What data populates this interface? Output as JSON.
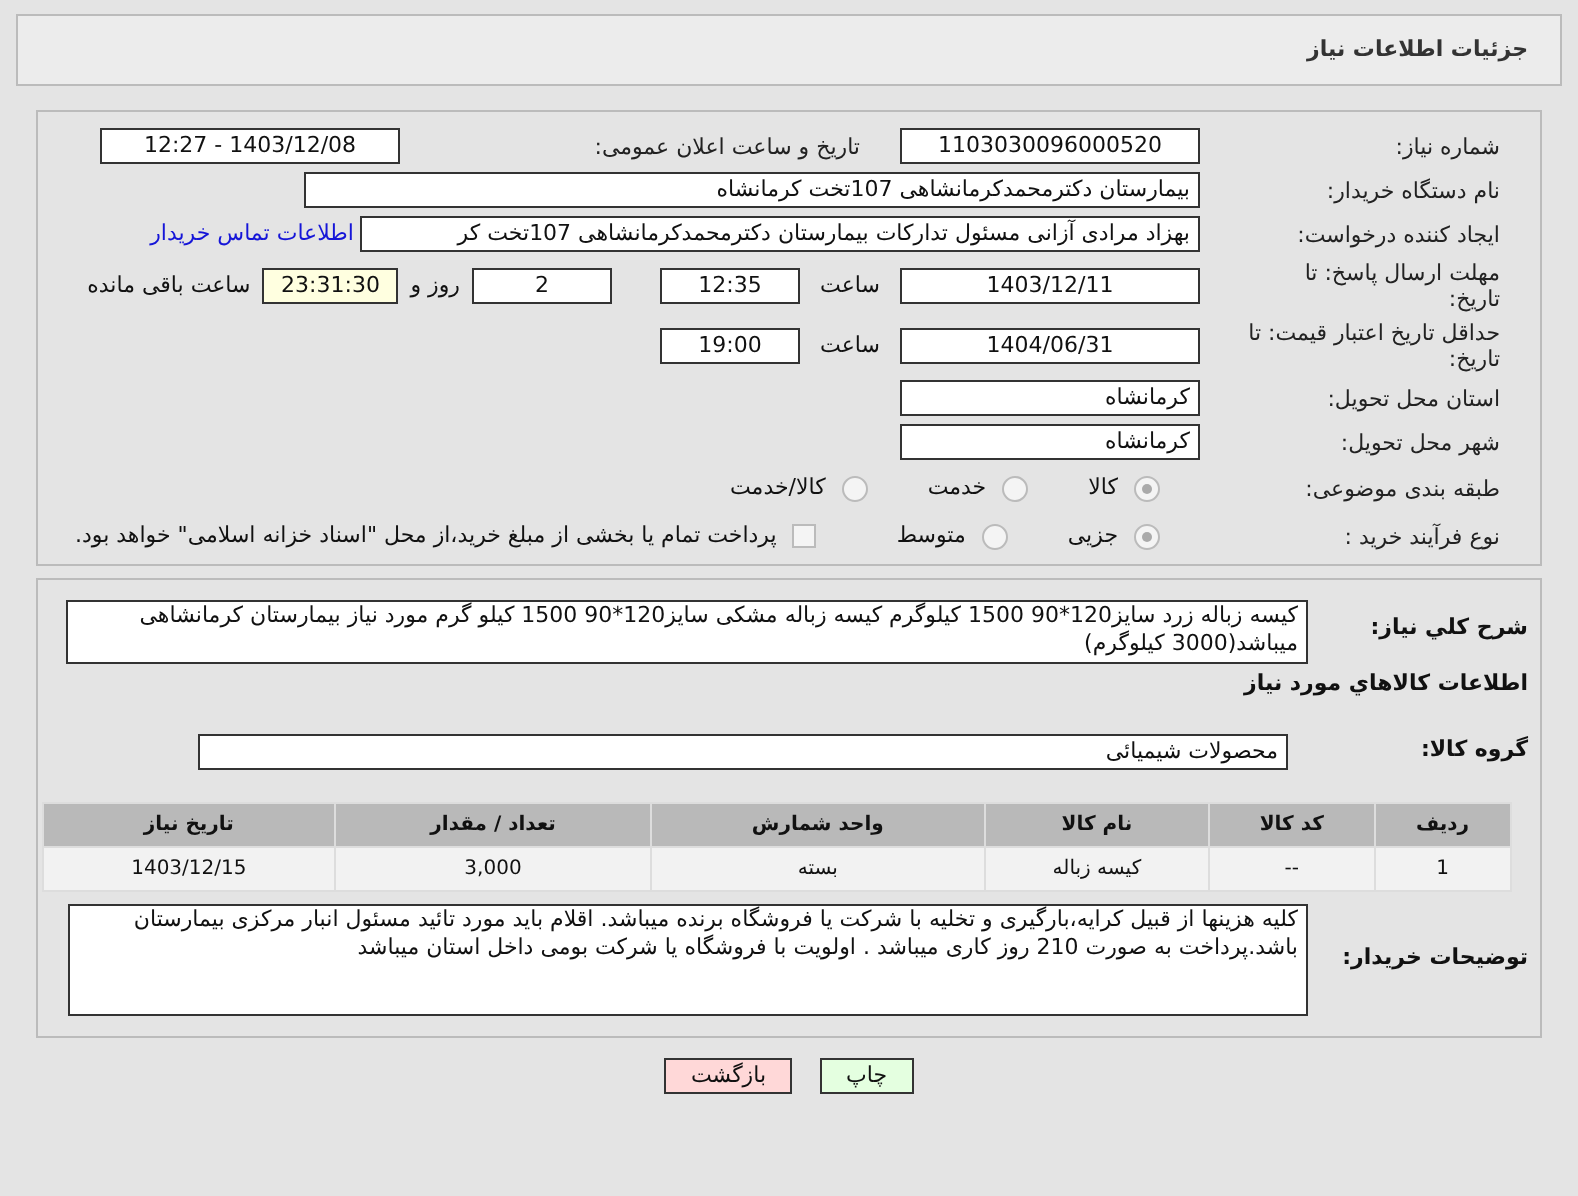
{
  "header": {
    "title": "جزئیات اطلاعات نیاز"
  },
  "need_number": {
    "label": "شماره نیاز:",
    "value": "1103030096000520"
  },
  "announce": {
    "label": "تاریخ و ساعت اعلان عمومی:",
    "value": "1403/12/08 - 12:27"
  },
  "buyer_org": {
    "label": "نام دستگاه خریدار:",
    "value": "بیمارستان دکترمحمدکرمانشاهی 107تخت کرمانشاه"
  },
  "requester": {
    "label": "ایجاد کننده درخواست:",
    "value": "بهزاد مرادی آزانی مسئول تدارکات بیمارستان دکترمحمدکرمانشاهی 107تخت کر",
    "link": "اطلاعات تماس خریدار"
  },
  "deadline": {
    "label": "مهلت ارسال پاسخ: تا\nتاریخ:",
    "date": "1403/12/11",
    "time_label": "ساعت",
    "time": "12:35",
    "days": "2",
    "days_label": "روز و",
    "remaining": "23:31:30",
    "remaining_label": "ساعت باقی مانده"
  },
  "validity": {
    "label": "حداقل تاریخ اعتبار قیمت: تا\nتاریخ:",
    "date": "1404/06/31",
    "time_label": "ساعت",
    "time": "19:00"
  },
  "province": {
    "label": "استان محل تحویل:",
    "value": "کرمانشاه"
  },
  "city": {
    "label": "شهر محل تحویل:",
    "value": "کرمانشاه"
  },
  "category": {
    "label": "طبقه بندی موضوعی:",
    "options": [
      {
        "label": "کالا",
        "selected": true
      },
      {
        "label": "خدمت",
        "selected": false
      },
      {
        "label": "کالا/خدمت",
        "selected": false
      }
    ]
  },
  "process": {
    "label": "نوع فرآیند خرید :",
    "options": [
      {
        "label": "جزیی",
        "selected": true
      },
      {
        "label": "متوسط",
        "selected": false
      }
    ],
    "payment_note": {
      "label": "پرداخت تمام یا بخشی از مبلغ خرید،از محل \"اسناد خزانه اسلامی\" خواهد بود.",
      "checked": false
    }
  },
  "description": {
    "label": "شرح کلي نياز:",
    "value": "کیسه زباله زرد سایز120*90 1500 کیلوگرم کیسه زباله مشکی سایز120*90 1500 کیلو گرم  مورد نیاز بیمارستان کرمانشاهی میباشد(3000 کیلوگرم)"
  },
  "goods_title": "اطلاعات کالاهاي مورد نياز",
  "goods_group": {
    "label": "گروه کالا:",
    "value": "محصولات شیمیائی"
  },
  "table": {
    "columns": [
      "ردیف",
      "کد کالا",
      "نام کالا",
      "واحد شمارش",
      "تعداد / مقدار",
      "تاریخ نیاز"
    ],
    "rows": [
      [
        "1",
        "--",
        "کیسه زباله",
        "بسته",
        "3,000",
        "1403/12/15"
      ]
    ]
  },
  "buyer_notes": {
    "label": "توضیحات خریدار:",
    "value": "کلیه هزینها از قبیل کرایه،بارگیری و تخلیه با شرکت یا فروشگاه برنده میباشد. اقلام باید مورد تائید مسئول انبار مرکزی بیمارستان باشد.پرداخت به صورت 210 روز کاری میباشد . اولویت با فروشگاه یا شرکت بومی داخل استان میباشد"
  },
  "buttons": [
    {
      "label": "چاپ",
      "kind": "print"
    },
    {
      "label": "بازگشت",
      "kind": "back"
    }
  ]
}
